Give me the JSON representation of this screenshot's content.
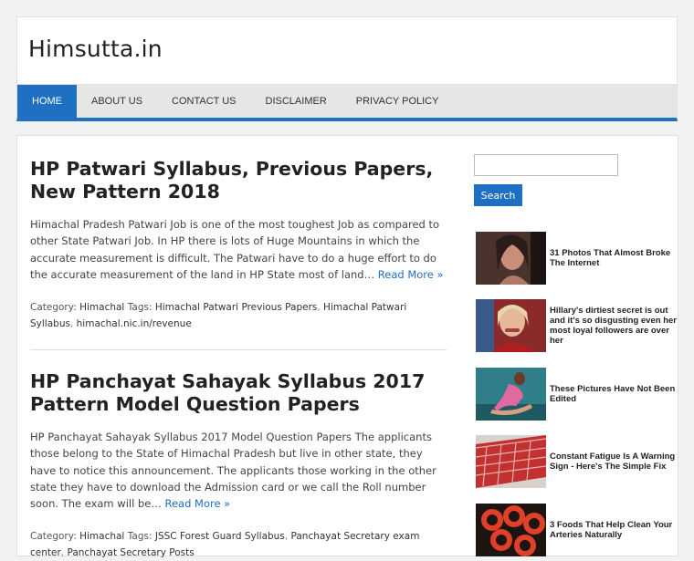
{
  "site": {
    "title": "Himsutta.in"
  },
  "nav": {
    "items": [
      {
        "label": "HOME",
        "active": true
      },
      {
        "label": "ABOUT US"
      },
      {
        "label": "CONTACT US"
      },
      {
        "label": "DISCLAIMER"
      },
      {
        "label": "PRIVACY POLICY"
      }
    ]
  },
  "posts": [
    {
      "title": "HP Patwari Syllabus, Previous Papers, New Pattern 2018",
      "excerpt": "Himachal Pradesh Patwari Job is one of the most toughest Job as compared to other State Patwari Job. In HP there is lots of Huge Mountains in which the accurate measurement is difficult. The Patwari have to do a huge effort to do the accurate measurement of the land in HP State most of land…",
      "read_more": "Read More »",
      "category_label": "Category:",
      "category": "Himachal",
      "tags_label": "Tags:",
      "tags": [
        "Himachal Patwari Previous Papers",
        "Himachal Patwari Syllabus",
        "himachal.nic.in/revenue"
      ]
    },
    {
      "title": "HP Panchayat Sahayak Syllabus 2017 Pattern Model Question Papers",
      "excerpt": "HP Panchayat Sahayak Syllabus 2017  Model Question Papers The applicants those belong to the State of Himachal Pradesh but live in other state, they have to notice this announcement. The applicants those working in the other state they have to download the Admission card or we call the Roll number soon. The exam will be…",
      "read_more": "Read More »",
      "category_label": "Category:",
      "category": "Himachal",
      "tags_label": "Tags:",
      "tags": [
        "JSSC Forest Guard Syllabus",
        "Panchayat Secretary exam center",
        "Panchayat Secretary Posts"
      ]
    }
  ],
  "sidebar": {
    "search": {
      "placeholder": "",
      "button_label": "Search"
    },
    "ads": [
      {
        "text": "31 Photos That Almost Broke The Internet",
        "image": "woman-portrait-image"
      },
      {
        "text": "Hillary's dirtiest secret is out and it's so disgusting even her most loyal followers are over her",
        "image": "politician-portrait-image"
      },
      {
        "text": "These Pictures Have Not Been Edited",
        "image": "pink-pose-image"
      },
      {
        "text": "Constant Fatigue Is A Warning Sign - Here's The Simple Fix",
        "image": "red-food-tray-image"
      },
      {
        "text": "3 Foods That Help Clean Your Arteries Naturally",
        "image": "pepper-rings-image"
      }
    ]
  },
  "colors": {
    "accent": "#1f6fc2",
    "nav_bg": "#e6e6e6",
    "page_bg": "#f2f2f2"
  }
}
